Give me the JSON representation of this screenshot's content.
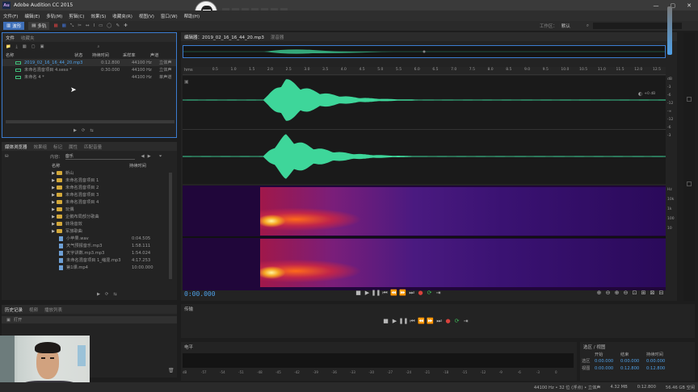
{
  "app": {
    "title": "Adobe Audition CC 2015",
    "logo_text": "Au",
    "window_controls": [
      "—",
      "▢",
      "✕"
    ]
  },
  "menu": {
    "items": [
      "文件(F)",
      "编辑(E)",
      "多轨(M)",
      "剪辑(C)",
      "效果(S)",
      "收藏夹(R)",
      "视图(V)",
      "窗口(W)",
      "帮助(H)"
    ]
  },
  "toolbar": {
    "mode_waveform": "波形",
    "mode_multitrack": "多轨",
    "workspace_label": "工作区：",
    "workspace_value": "默认",
    "search_label": "搜索"
  },
  "files_panel": {
    "tabs": [
      "文件",
      "收藏夹"
    ],
    "columns": [
      "名称",
      "状态",
      "持续时间",
      "采样率",
      "声道"
    ],
    "rows": [
      {
        "name": "2019_02_16_16_44_20.mp3",
        "status": "",
        "duration": "0:12.800",
        "rate": "44100 Hz",
        "channels": "立体声"
      },
      {
        "name": "未命名混音项目 4.sesx *",
        "status": "",
        "duration": "0:30.000",
        "rate": "44100 Hz",
        "channels": "立体声"
      },
      {
        "name": "未命名 4 *",
        "status": "",
        "duration": "",
        "rate": "44100 Hz",
        "channels": "单声道"
      }
    ]
  },
  "media_browser": {
    "tabs": [
      "媒体浏览器",
      "效果组",
      "标记",
      "属性",
      "匹配音量"
    ],
    "content_label": "内容：",
    "content_value": "音乐",
    "columns": [
      "名称",
      "持续时间"
    ],
    "folders": [
      "新山",
      "未命名混音项目 1",
      "未命名混音项目 2",
      "未命名混音项目 3",
      "未命名混音项目 4",
      "玩偶",
      "企鹅布局部分歌曲",
      "转场音效",
      "军旅歌曲"
    ],
    "files": [
      {
        "name": "小苹果.wav",
        "duration": "0:04.505"
      },
      {
        "name": "天气预报音乐.mp3",
        "duration": "1:58.111"
      },
      {
        "name": "天宇讲数.mp3.mp3",
        "duration": "1:54.024"
      },
      {
        "name": "未命名混音项目 1_缩混.mp3",
        "duration": "4:17.253"
      },
      {
        "name": "第1课.mp4",
        "duration": "10:00.000"
      }
    ]
  },
  "history_panel": {
    "tabs": [
      "历史记录",
      "视频",
      "播放列表"
    ],
    "items": [
      "打开"
    ]
  },
  "editor": {
    "tabs": [
      "编辑器：2019_02_16_16_44_20.mp3",
      "混音器"
    ],
    "time_display": "0:00.000",
    "ruler_unit": "hms",
    "ruler_ticks": [
      "0.5",
      "1.0",
      "1.5",
      "2.0",
      "2.5",
      "3.0",
      "3.5",
      "4.0",
      "4.5",
      "5.0",
      "5.5",
      "6.0",
      "6.5",
      "7.0",
      "7.5",
      "8.0",
      "8.5",
      "9.0",
      "9.5",
      "10.0",
      "10.5",
      "11.0",
      "11.5",
      "12.0",
      "12.5"
    ],
    "db_labels": [
      "dB",
      "-3",
      "-6",
      "-12",
      "-∞",
      "-12",
      "-6",
      "-3"
    ],
    "hz_labels": [
      "Hz",
      "10k",
      "1k",
      "100",
      "10"
    ],
    "gain": "+0 dB"
  },
  "transport_panel": {
    "title": "传输"
  },
  "level_panel": {
    "title": "电平",
    "scale": [
      "dB",
      "-57",
      "-54",
      "-51",
      "-48",
      "-45",
      "-42",
      "-39",
      "-36",
      "-33",
      "-30",
      "-27",
      "-24",
      "-21",
      "-18",
      "-15",
      "-12",
      "-9",
      "-6",
      "-3",
      "0"
    ]
  },
  "selection_panel": {
    "title": "选区 / 视图",
    "columns": [
      "开始",
      "结束",
      "持续时间"
    ],
    "rows": [
      {
        "label": "选区",
        "start": "0:00.000",
        "end": "0:00.000",
        "duration": "0:00.000"
      },
      {
        "label": "视图",
        "start": "0:00.000",
        "end": "0:12.800",
        "duration": "0:12.800"
      }
    ]
  },
  "status_bar": {
    "format": "44100 Hz • 32 位 (浮点) • 立体声",
    "size": "4.32 MB",
    "duration": "0:12.800",
    "free": "56.46 GB 空闲"
  },
  "colors": {
    "waveform": "#3ed69a",
    "accent_blue": "#4ea0e8",
    "record_red": "#d9423c"
  }
}
